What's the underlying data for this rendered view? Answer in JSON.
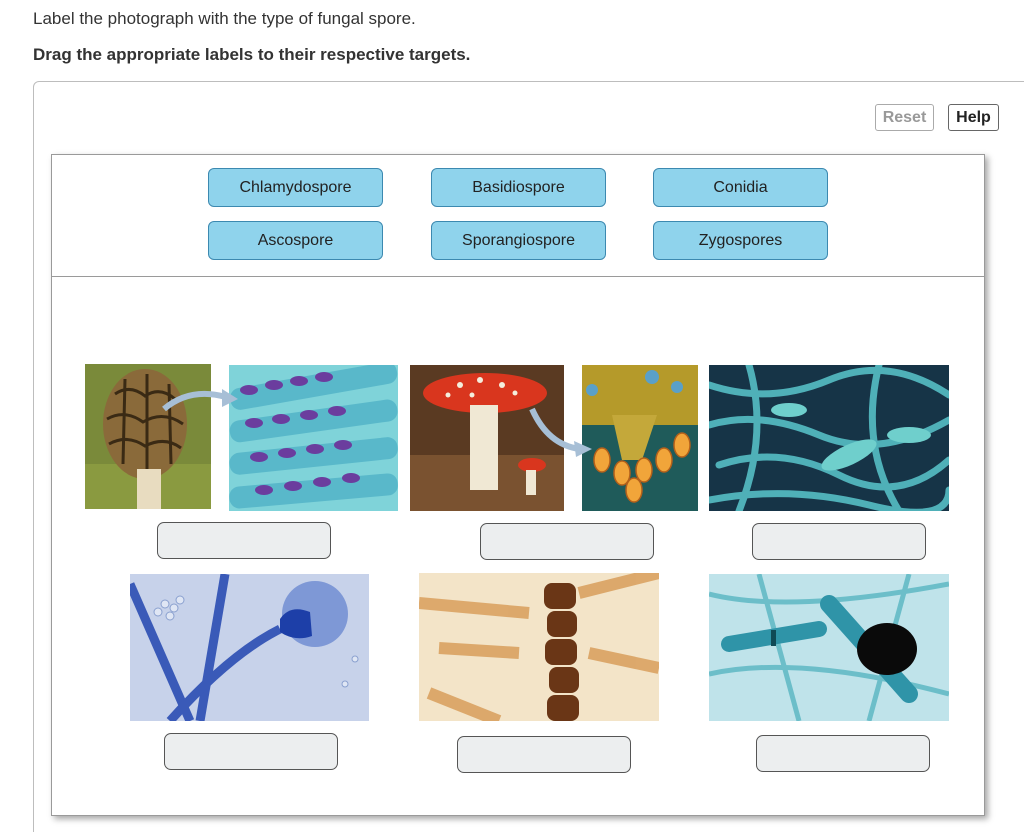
{
  "instructions": {
    "line1": "Label the photograph with the type of fungal spore.",
    "line2": "Drag the appropriate labels to their respective targets."
  },
  "toolbar": {
    "reset_label": "Reset",
    "help_label": "Help"
  },
  "label_bank": [
    {
      "text": "Chlamydospore"
    },
    {
      "text": "Basidiospore"
    },
    {
      "text": "Conidia"
    },
    {
      "text": "Ascospore"
    },
    {
      "text": "Sporangiospore"
    },
    {
      "text": "Zygospores"
    }
  ],
  "colors": {
    "chip_fill": "#8fd3ec",
    "chip_border": "#3c89b0",
    "target_fill": "#eceeef"
  },
  "photos": [
    {
      "subject": "morel mushroom with microscopic asci"
    },
    {
      "subject": "fly agaric mushroom with basidia micrograph"
    },
    {
      "subject": "blue-green hyphae with conidia (SEM)"
    },
    {
      "subject": "sporangium on sporangiophore, blue stain"
    },
    {
      "subject": "brown chlamydospore chains in hyphae"
    },
    {
      "subject": "dark zygospore between teal hyphae"
    }
  ]
}
